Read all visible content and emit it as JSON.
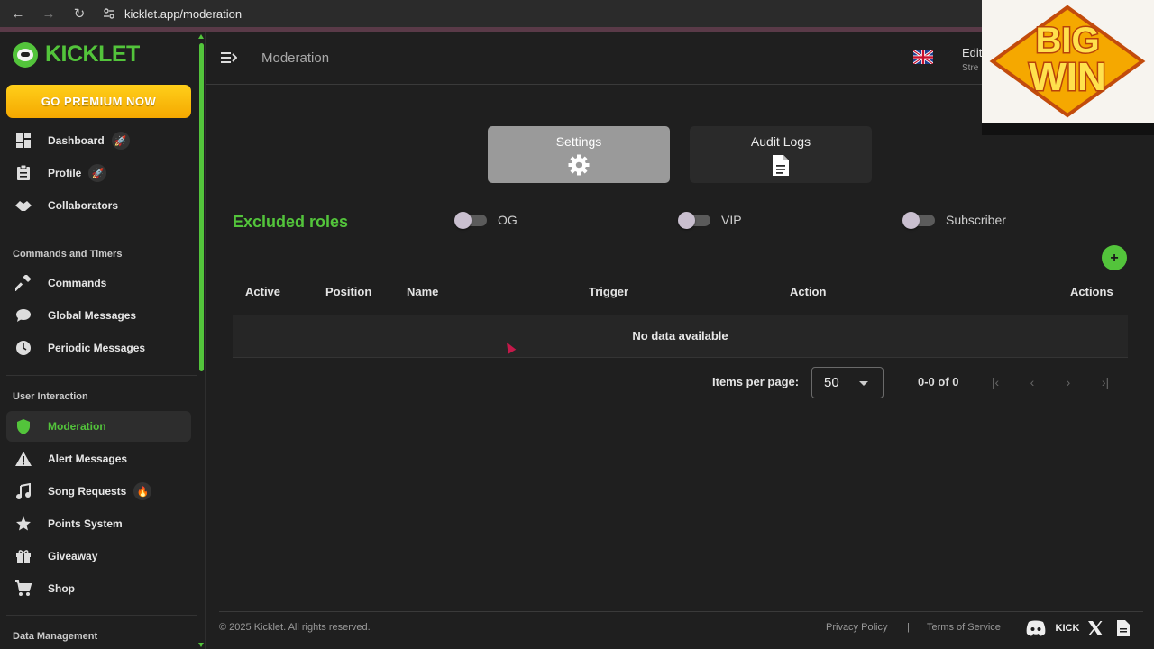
{
  "browser": {
    "url": "kicklet.app/moderation"
  },
  "brand": {
    "name": "KICKLET",
    "accent": "#53c43b",
    "premium_label": "GO PREMIUM NOW"
  },
  "sidebar": {
    "items_top": [
      {
        "label": "Dashboard",
        "icon": "dashboard-icon",
        "badge": "rocket"
      },
      {
        "label": "Profile",
        "icon": "clipboard-icon",
        "badge": "rocket"
      },
      {
        "label": "Collaborators",
        "icon": "handshake-icon"
      }
    ],
    "section_commands": "Commands and Timers",
    "items_commands": [
      {
        "label": "Commands",
        "icon": "hammer-icon"
      },
      {
        "label": "Global Messages",
        "icon": "chat-bubble-icon"
      },
      {
        "label": "Periodic Messages",
        "icon": "clock-icon"
      }
    ],
    "section_interaction": "User Interaction",
    "items_interaction": [
      {
        "label": "Moderation",
        "icon": "shield-icon",
        "active": true
      },
      {
        "label": "Alert Messages",
        "icon": "warning-icon"
      },
      {
        "label": "Song Requests",
        "icon": "music-note-icon",
        "badge": "fire"
      },
      {
        "label": "Points System",
        "icon": "star-icon"
      },
      {
        "label": "Giveaway",
        "icon": "gift-icon"
      },
      {
        "label": "Shop",
        "icon": "cart-icon"
      }
    ],
    "section_data": "Data Management"
  },
  "header": {
    "title": "Moderation",
    "user_line1": "Edit",
    "user_line2": "Stre"
  },
  "overlay": {
    "line1": "BIG",
    "line2": "WIN"
  },
  "tabs": {
    "settings": "Settings",
    "audit": "Audit Logs"
  },
  "excluded": {
    "title": "Excluded roles",
    "roles": [
      "OG",
      "VIP",
      "Subscriber"
    ]
  },
  "table": {
    "add_label": "+",
    "headers": [
      "Active",
      "Position",
      "Name",
      "Trigger",
      "Action",
      "Actions"
    ],
    "empty_text": "No data available"
  },
  "pager": {
    "label": "Items per page:",
    "value": "50",
    "range": "0-0 of 0"
  },
  "footer": {
    "copyright": "© 2025 Kicklet. All rights reserved.",
    "privacy": "Privacy Policy",
    "separator": "|",
    "terms": "Terms of Service",
    "kick_label": "KICK"
  }
}
